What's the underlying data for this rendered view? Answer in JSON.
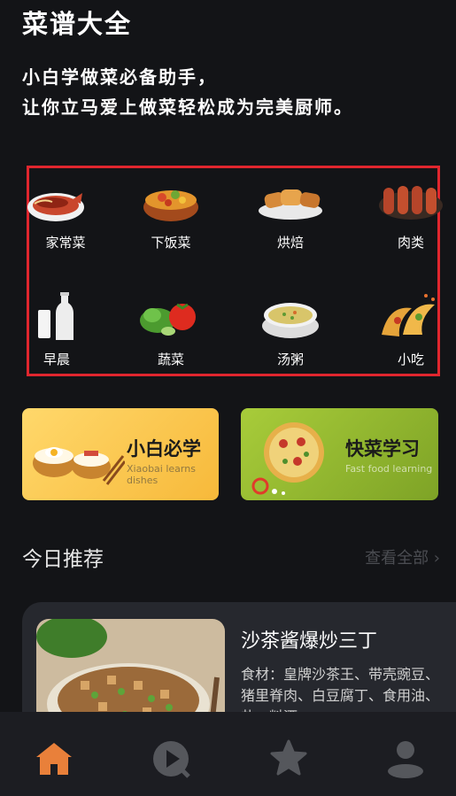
{
  "header": {
    "title": "菜谱大全",
    "slogan_line1": "小白学做菜必备助手，",
    "slogan_line2": "让你立马爱上做菜轻松成为完美厨师。"
  },
  "categories": [
    {
      "label": "家常菜",
      "icon": "braised-fish-icon"
    },
    {
      "label": "下饭菜",
      "icon": "stir-fry-pot-icon"
    },
    {
      "label": "烘焙",
      "icon": "bread-icon"
    },
    {
      "label": "肉类",
      "icon": "sausage-icon"
    },
    {
      "label": "早晨",
      "icon": "milk-icon"
    },
    {
      "label": "蔬菜",
      "icon": "vegetables-icon"
    },
    {
      "label": "汤粥",
      "icon": "soup-bowl-icon"
    },
    {
      "label": "小吃",
      "icon": "taco-icon"
    }
  ],
  "promos": [
    {
      "title": "小白必学",
      "subtitle": "Xiaobai learns dishes"
    },
    {
      "title": "快菜学习",
      "subtitle": "Fast food learning"
    }
  ],
  "recommend": {
    "section_title": "今日推荐",
    "see_all": "查看全部 ›",
    "dish_name": "沙茶酱爆炒三丁",
    "ingredients": "食材：皇牌沙茶王、带壳豌豆、猪里脊肉、白豆腐丁、食用油、盐、料酒"
  },
  "tabbar": [
    {
      "icon": "home-icon",
      "active": true
    },
    {
      "icon": "video-play-icon",
      "active": false
    },
    {
      "icon": "star-icon",
      "active": false
    },
    {
      "icon": "user-icon",
      "active": false
    }
  ],
  "colors": {
    "background": "#131417",
    "highlight_border": "#e0262e",
    "tab_active": "#e9803a",
    "tab_inactive": "#55575c"
  }
}
